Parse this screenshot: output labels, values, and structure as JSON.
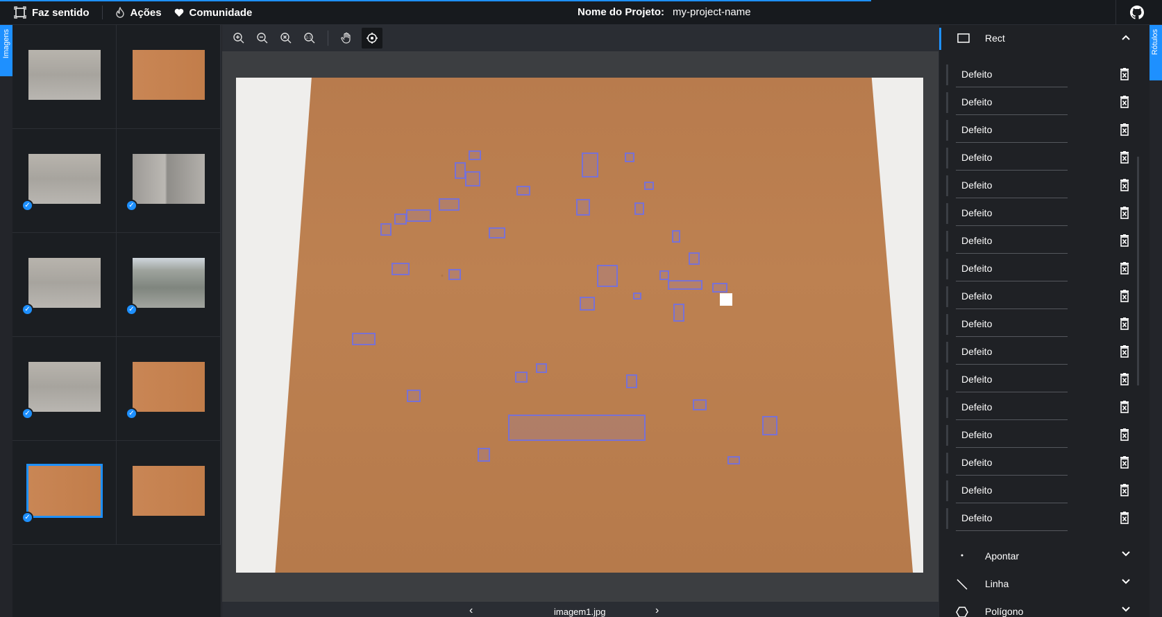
{
  "topbar": {
    "progress_percent": 80,
    "nav": [
      {
        "label": "Faz sentido",
        "icon": "frame-icon"
      },
      {
        "label": "Ações",
        "icon": "flame-icon"
      },
      {
        "label": "Comunidade",
        "icon": "heart-icon"
      }
    ],
    "project_label": "Nome do Projeto:",
    "project_name": "my-project-name"
  },
  "left_tab": {
    "label": "Imagens"
  },
  "right_tab": {
    "label": "Rótulos"
  },
  "thumbnails": [
    {
      "style": "fabric",
      "checked": false,
      "selected": false
    },
    {
      "style": "cork2",
      "checked": false,
      "selected": false
    },
    {
      "style": "fabric",
      "checked": true,
      "selected": false
    },
    {
      "style": "fabric2",
      "checked": true,
      "selected": false
    },
    {
      "style": "fabric",
      "checked": true,
      "selected": false
    },
    {
      "style": "photo2",
      "checked": true,
      "selected": false
    },
    {
      "style": "fabric",
      "checked": true,
      "selected": false
    },
    {
      "style": "cork2",
      "checked": true,
      "selected": false
    },
    {
      "style": "cork2",
      "checked": true,
      "selected": true
    },
    {
      "style": "cork2",
      "checked": false,
      "selected": false
    }
  ],
  "toolbar": [
    "zoom-in-icon",
    "zoom-out-icon",
    "zoom-fit-icon",
    "zoom-reset-icon",
    "pan-hand-icon",
    "select-crosshair-icon"
  ],
  "canvas": {
    "filename": "imagem1.jpg"
  },
  "labels_panel": {
    "active_tool": "Rect",
    "labels": [
      "Defeito",
      "Defeito",
      "Defeito",
      "Defeito",
      "Defeito",
      "Defeito",
      "Defeito",
      "Defeito",
      "Defeito",
      "Defeito",
      "Defeito",
      "Defeito",
      "Defeito",
      "Defeito",
      "Defeito",
      "Defeito",
      "Defeito"
    ],
    "sections": [
      "Apontar",
      "Linha",
      "Polígono"
    ]
  },
  "colors": {
    "accent": "#1e90ff",
    "box": "#6e6ee6"
  }
}
